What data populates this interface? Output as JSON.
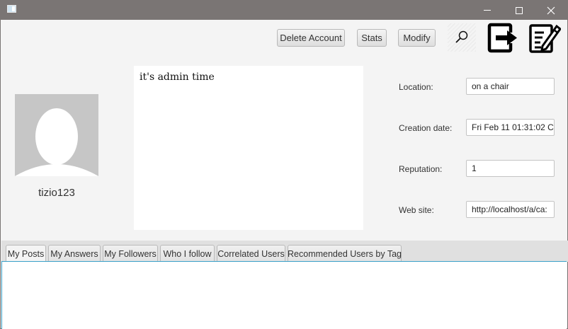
{
  "toolbar": {
    "delete_label": "Delete Account",
    "stats_label": "Stats",
    "modify_label": "Modify"
  },
  "profile": {
    "username": "tizio123",
    "bio": "it's admin time"
  },
  "fields": {
    "location_label": "Location:",
    "location_value": "on a chair",
    "creation_label": "Creation date:",
    "creation_value": "Fri Feb 11 01:31:02 C",
    "reputation_label": "Reputation:",
    "reputation_value": "1",
    "website_label": "Web site:",
    "website_value": "http://localhost/a/ca:"
  },
  "tabs": [
    {
      "label": "My Posts"
    },
    {
      "label": "My Answers"
    },
    {
      "label": "My Followers"
    },
    {
      "label": "Who I follow"
    },
    {
      "label": "Correlated Users"
    },
    {
      "label": "Recommended Users by Tag"
    }
  ],
  "icons": {
    "search": "search-icon",
    "logout": "logout-icon",
    "edit": "edit-icon",
    "avatar": "avatar-placeholder"
  },
  "colors": {
    "titlebar": "#7a7574",
    "focus_border": "#3aa0c8"
  }
}
